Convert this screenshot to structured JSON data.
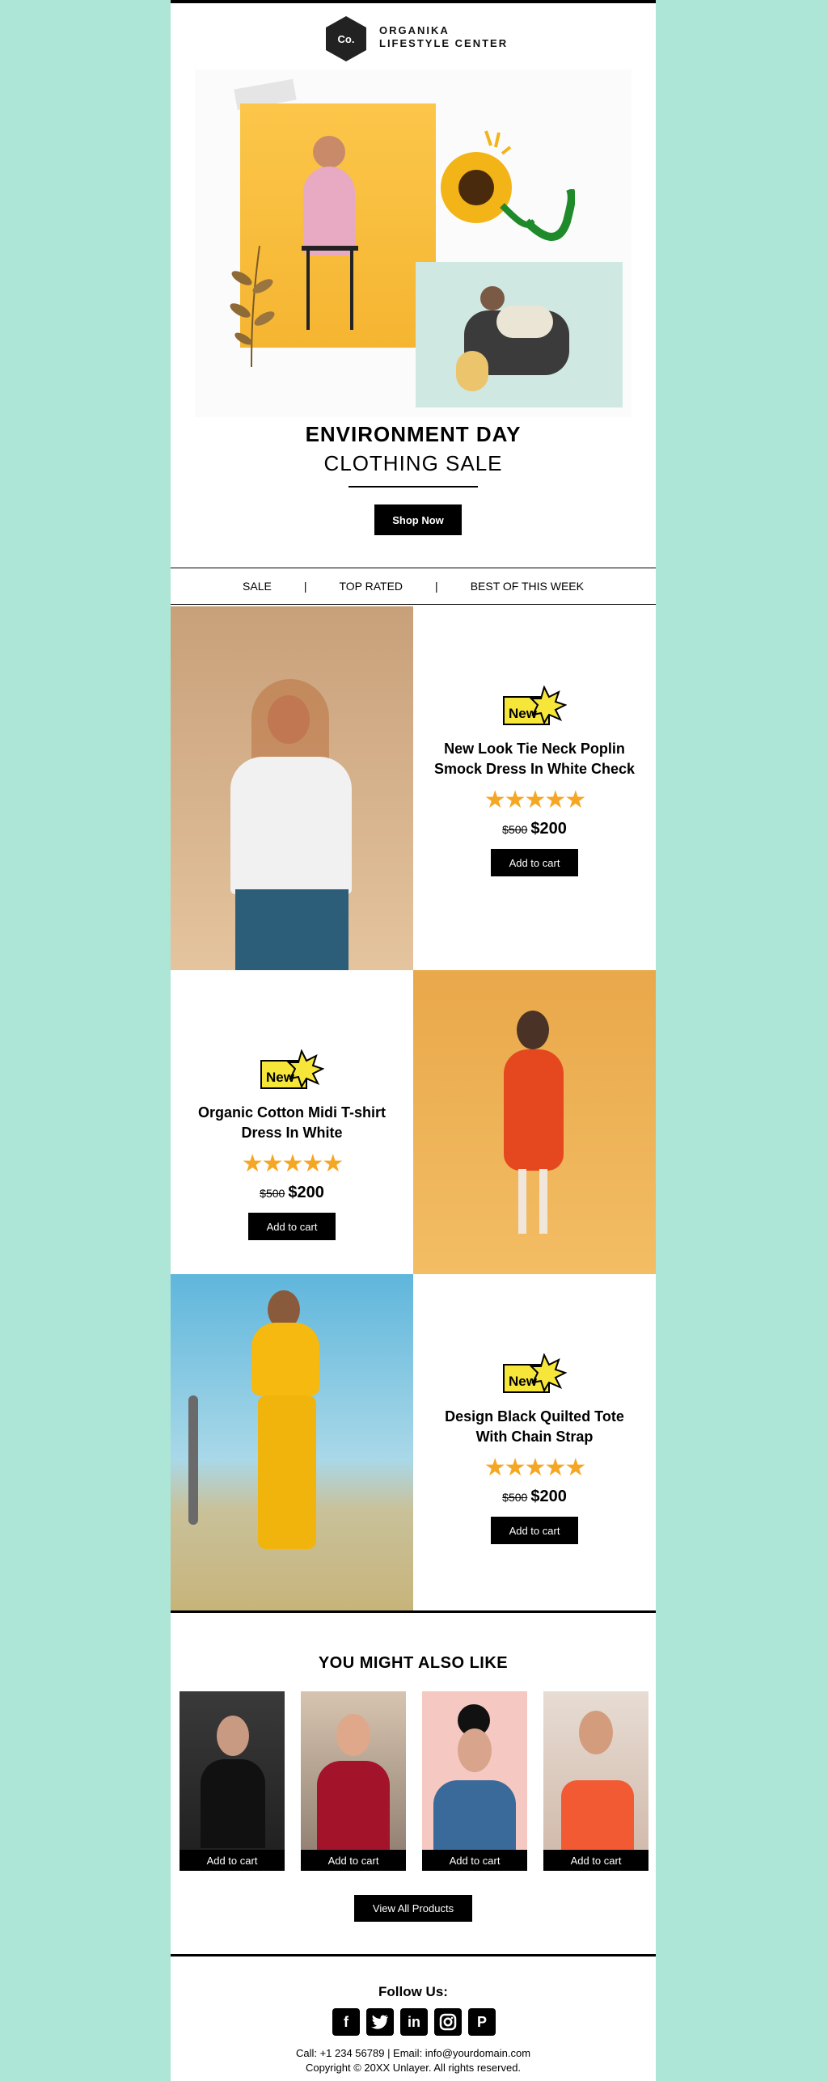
{
  "brand": {
    "logo_text": "Co.",
    "line1": "ORGANIKA",
    "line2": "LIFESTYLE CENTER"
  },
  "hero": {
    "title": "ENVIRONMENT DAY",
    "subtitle": "CLOTHING SALE",
    "cta": "Shop Now"
  },
  "nav": {
    "items": [
      "SALE",
      "TOP RATED",
      "BEST OF THIS WEEK"
    ],
    "separator": "|"
  },
  "products": [
    {
      "badge": "New",
      "name_line1": "New Look Tie Neck Poplin",
      "name_line2": "Smock Dress In White Check",
      "stars": "★★★★★",
      "old_price": "$500",
      "price": "$200",
      "cta": "Add to cart"
    },
    {
      "badge": "New",
      "name_line1": "Organic Cotton Midi T-shirt",
      "name_line2": "Dress In White",
      "stars": "★★★★★",
      "old_price": "$500",
      "price": "$200",
      "cta": "Add to cart"
    },
    {
      "badge": "New",
      "name_line1": "Design Black Quilted Tote",
      "name_line2": "With Chain Strap",
      "stars": "★★★★★",
      "old_price": "$500",
      "price": "$200",
      "cta": "Add to cart"
    }
  ],
  "recommend": {
    "title": "YOU MIGHT ALSO LIKE",
    "items": [
      {
        "cta": "Add to cart"
      },
      {
        "cta": "Add to cart"
      },
      {
        "cta": "Add to cart"
      },
      {
        "cta": "Add to cart"
      }
    ],
    "view_all": "View All Products"
  },
  "footer": {
    "follow": "Follow Us:",
    "social": [
      "facebook-icon",
      "twitter-icon",
      "linkedin-icon",
      "instagram-icon",
      "pinterest-icon"
    ],
    "contact": "Call: +1 234 56789 | Email: info@yourdomain.com",
    "copyright": "Copyright © 20XX Unlayer. All rights reserved."
  },
  "colors": {
    "background": "#ade5d6",
    "stars": "#f5a623",
    "badge": "#f7e63a",
    "button": "#000000"
  }
}
